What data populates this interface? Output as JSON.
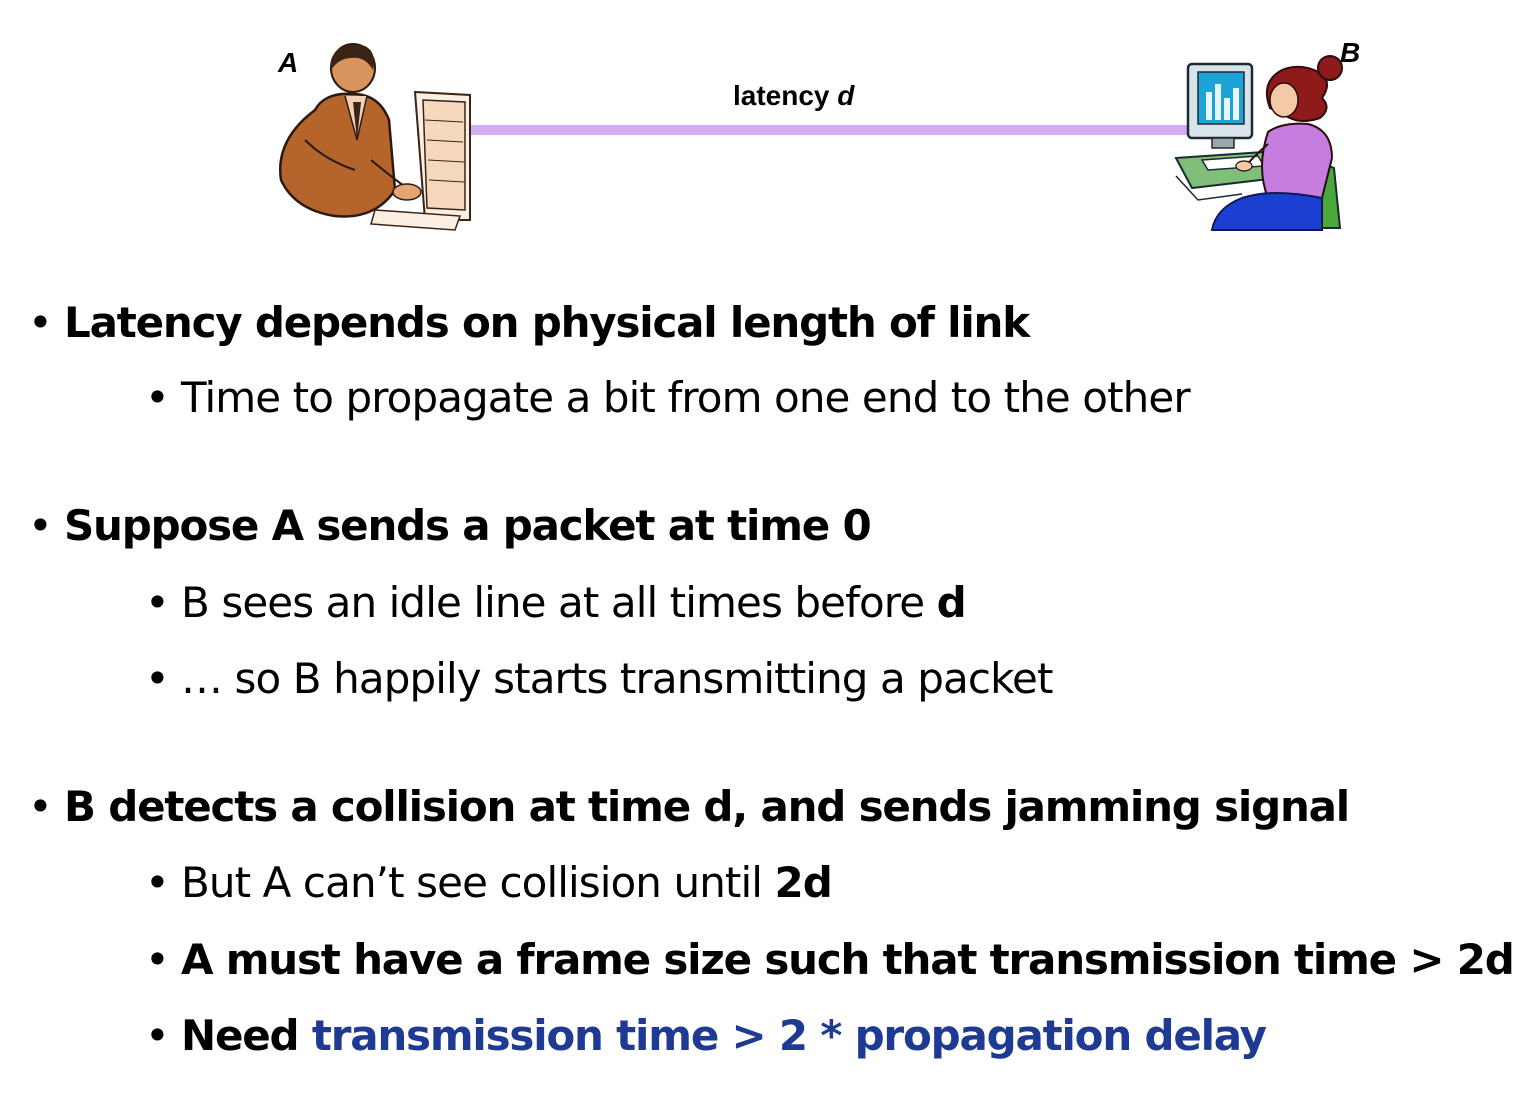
{
  "diagram": {
    "node_a_label": "A",
    "node_b_label": "B",
    "latency_text": "latency",
    "latency_var": "d",
    "link_color": "#d2aef4"
  },
  "bullets": {
    "b1": {
      "text": "Latency depends on physical length of link"
    },
    "b1_1": {
      "text": "Time to propagate a bit from one end to the other"
    },
    "b2": {
      "text": "Suppose A sends a packet at time 0"
    },
    "b2_1": {
      "prefix": "B sees an idle line at all times before ",
      "bold": "d"
    },
    "b2_2": {
      "text": "… so B happily starts transmitting a packet"
    },
    "b3": {
      "text": "B detects a collision at time d, and sends jamming signal"
    },
    "b3_1": {
      "prefix": "But A can’t see collision until ",
      "bold": "2d"
    },
    "b3_2": {
      "text": "A must have a frame size such that transmission time > 2d"
    },
    "b3_3": {
      "prefix": "Need ",
      "highlight": "transmission time > 2 * propagation delay"
    }
  },
  "colors": {
    "highlight_blue": "#1f3a93",
    "text": "#000000"
  }
}
